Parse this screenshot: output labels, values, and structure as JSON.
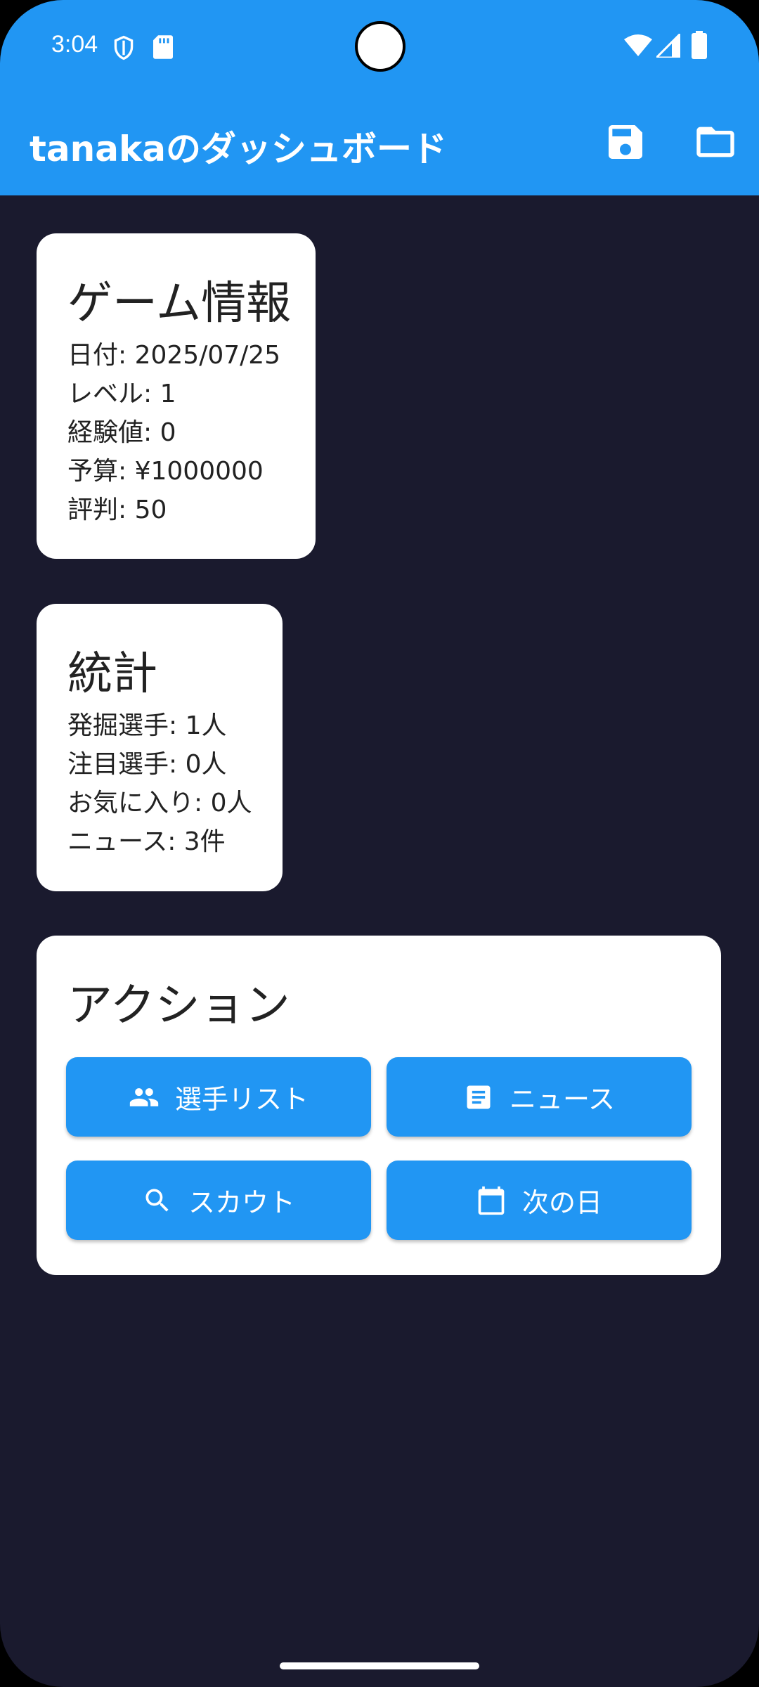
{
  "status_bar": {
    "time": "3:04"
  },
  "app_bar": {
    "title": "tanakaのダッシュボード",
    "save_icon": "save-icon",
    "folder_icon": "folder-icon"
  },
  "game_info": {
    "title": "ゲーム情報",
    "lines": [
      "日付: 2025/07/25",
      "レベル: 1",
      "経験値: 0",
      "予算: ¥1000000",
      "評判: 50"
    ]
  },
  "stats": {
    "title": "統計",
    "lines": [
      "発掘選手: 1人",
      "注目選手: 0人",
      "お気に入り: 0人",
      "ニュース: 3件"
    ]
  },
  "actions": {
    "title": "アクション",
    "buttons": [
      {
        "label": "選手リスト",
        "icon": "people-icon"
      },
      {
        "label": "ニュース",
        "icon": "article-icon"
      },
      {
        "label": "スカウト",
        "icon": "search-icon"
      },
      {
        "label": "次の日",
        "icon": "calendar-icon"
      }
    ]
  },
  "colors": {
    "primary": "#2196f3",
    "background": "#1a1a2e",
    "card": "#ffffff"
  }
}
